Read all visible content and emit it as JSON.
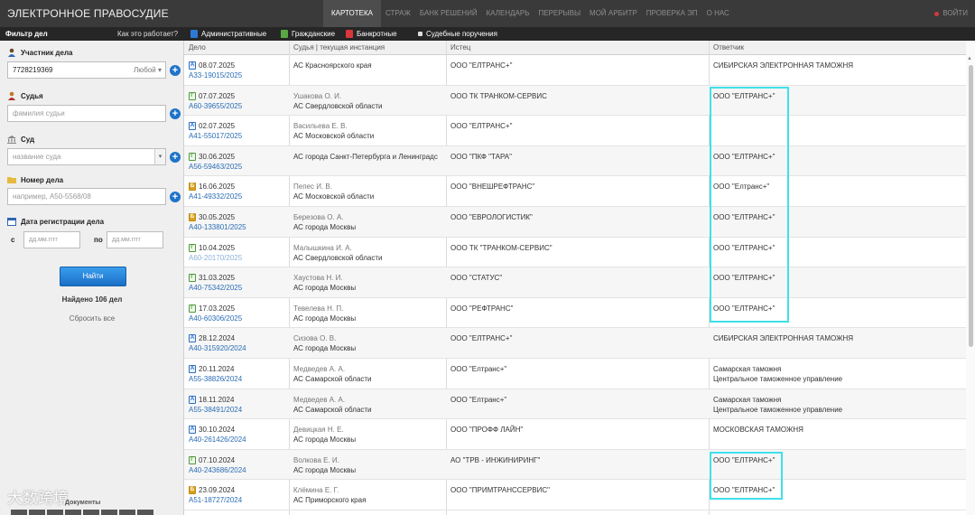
{
  "header": {
    "brand": "ЭЛЕКТРОННОЕ ПРАВОСУДИЕ",
    "nav": [
      "КАРТОТЕКА",
      "СТРАЖ",
      "БАНК РЕШЕНИЙ",
      "КАЛЕНДАРЬ",
      "ПЕРЕРЫВЫ",
      "МОЙ АРБИТР",
      "ПРОВЕРКА ЭП",
      "О НАС"
    ],
    "login": "ВОЙТИ"
  },
  "subbar": {
    "filter_title": "Фильтр дел",
    "howto": "Как это работает?",
    "tabs": [
      "Административные",
      "Гражданские",
      "Банкротные",
      "Судебные поручения"
    ]
  },
  "sidebar": {
    "participant_label": "Участник дела",
    "participant_value": "7728219369",
    "participant_role": "Любой",
    "judge_label": "Судья",
    "judge_placeholder": "фамилия судьи",
    "court_label": "Суд",
    "court_placeholder": "название суда",
    "case_number_label": "Номер дела",
    "case_number_placeholder": "например, А50-5568/08",
    "reg_date_label": "Дата регистрации дела",
    "date_from_label": "с",
    "date_from_placeholder": "дд.мм.гггг",
    "date_to_label": "по",
    "date_to_placeholder": "дд.мм.гггг",
    "find_button": "Найти",
    "found_text": "Найдено 106 дел",
    "reset_text": "Сбросить все",
    "watermark": "大数跨境",
    "watermark_sub": "Документы"
  },
  "table": {
    "columns": [
      "Дело",
      "Судья | текущая инстанция",
      "Истец",
      "Ответчик"
    ],
    "rows": [
      {
        "type": "A",
        "date": "08.07.2025",
        "number": "А33-19015/2025",
        "judge": "",
        "court": "АС Красноярского края",
        "plaintiff": "ООО \"ЕЛТРАНС+\"",
        "defendant": [
          "СИБИРСКАЯ ЭЛЕКТРОННАЯ ТАМОЖНЯ"
        ]
      },
      {
        "type": "Г",
        "date": "07.07.2025",
        "number": "А60-39655/2025",
        "judge": "Ушакова О. И.",
        "court": "АС Свердловской области",
        "plaintiff": "ООО ТК ТРАНКОМ-СЕРВИС",
        "defendant": [
          "ООО \"ЕЛТРАНС+\""
        ]
      },
      {
        "type": "A",
        "date": "02.07.2025",
        "number": "А41-55017/2025",
        "judge": "Васильева Е. В.",
        "court": "АС Московской области",
        "plaintiff": "ООО \"ЕЛТРАНС+\"",
        "defendant": []
      },
      {
        "type": "Г",
        "date": "30.06.2025",
        "number": "А56-59463/2025",
        "judge": "",
        "court": "АС города Санкт-Петербурга и Ленинградс",
        "plaintiff": "ООО \"ПКФ \"ТАРА\"",
        "defendant": [
          "ООО \"ЕЛТРАНС+\""
        ]
      },
      {
        "type": "Б",
        "date": "16.06.2025",
        "number": "А41-49332/2025",
        "judge": "Пепес И. В.",
        "court": "АС Московской области",
        "plaintiff": "ООО \"ВНЕШРЕФТРАНС\"",
        "defendant": [
          "ООО \"Елтранс+\""
        ]
      },
      {
        "type": "Б",
        "date": "30.05.2025",
        "number": "А40-133801/2025",
        "judge": "Березова О. А.",
        "court": "АС города Москвы",
        "plaintiff": "ООО \"ЕВРОЛОГИСТИК\"",
        "defendant": [
          "ООО \"ЕЛТРАНС+\""
        ]
      },
      {
        "type": "Г",
        "date": "10.04.2025",
        "number": "А60-20170/2025",
        "judge": "Малышкина И. А.",
        "court": "АС Свердловской области",
        "plaintiff": "ООО ТК \"ТРАНКОМ-СЕРВИС\"",
        "defendant": [
          "ООО \"ЕЛТРАНС+\""
        ]
      },
      {
        "type": "Г",
        "date": "31.03.2025",
        "number": "А40-75342/2025",
        "judge": "Хаустова Н. И.",
        "court": "АС города Москвы",
        "plaintiff": "ООО \"СТАТУС\"",
        "defendant": [
          "ООО \"ЕЛТРАНС+\""
        ]
      },
      {
        "type": "Г",
        "date": "17.03.2025",
        "number": "А40-60306/2025",
        "judge": "Тевелева Н. П.",
        "court": "АС города Москвы",
        "plaintiff": "ООО \"РЕФТРАНС\"",
        "defendant": [
          "ООО \"ЕЛТРАНС+\""
        ]
      },
      {
        "type": "A",
        "date": "28.12.2024",
        "number": "А40-315920/2024",
        "judge": "Сизова О. В.",
        "court": "АС города Москвы",
        "plaintiff": "ООО \"ЕЛТРАНС+\"",
        "defendant": [
          "СИБИРСКАЯ ЭЛЕКТРОННАЯ ТАМОЖНЯ"
        ]
      },
      {
        "type": "A",
        "date": "20.11.2024",
        "number": "А55-38826/2024",
        "judge": "Медведев А. А.",
        "court": "АС Самарской области",
        "plaintiff": "ООО \"Елтранс+\"",
        "defendant": [
          "Самарская таможня",
          "Центральное таможенное управление"
        ]
      },
      {
        "type": "A",
        "date": "18.11.2024",
        "number": "А55-38491/2024",
        "judge": "Медведев А. А.",
        "court": "АС Самарской области",
        "plaintiff": "ООО \"Елтранс+\"",
        "defendant": [
          "Самарская таможня",
          "Центральное таможенное управление"
        ]
      },
      {
        "type": "A",
        "date": "30.10.2024",
        "number": "А40-261426/2024",
        "judge": "Девицкая Н. Е.",
        "court": "АС города Москвы",
        "plaintiff": "ООО \"ПРОФФ ЛАЙН\"",
        "defendant": [
          "МОСКОВСКАЯ ТАМОЖНЯ"
        ]
      },
      {
        "type": "Г",
        "date": "07.10.2024",
        "number": "А40-243686/2024",
        "judge": "Волкова Е. И.",
        "court": "АС города Москвы",
        "plaintiff": "АО \"ТРВ - ИНЖИНИРИНГ\"",
        "defendant": [
          "ООО \"ЕЛТРАНС+\""
        ]
      },
      {
        "type": "Б",
        "date": "23.09.2024",
        "number": "А51-18727/2024",
        "judge": "Клёмина Е. Г.",
        "court": "АС Приморского края",
        "plaintiff": "ООО \"ПРИМТРАНССЕРВИС\"",
        "defendant": [
          "ООО \"ЕЛТРАНС+\""
        ]
      }
    ]
  },
  "colors": {
    "topbar": "#3a3a3a",
    "subbar": "#262626",
    "link": "#2a6db5",
    "highlight": "#3fe0ea",
    "find_button": "#1a6fc7"
  }
}
